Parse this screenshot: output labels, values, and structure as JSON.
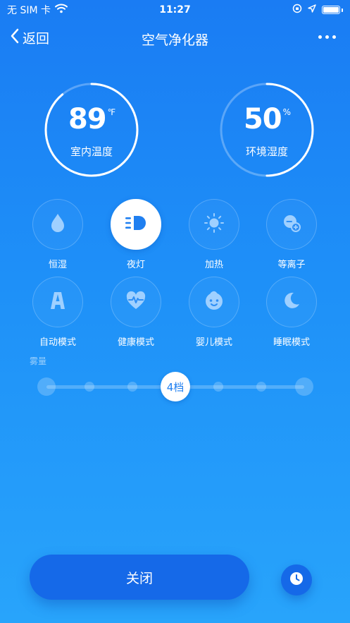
{
  "status_bar": {
    "carrier": "无 SIM 卡",
    "time": "11:27"
  },
  "nav": {
    "back_label": "返回",
    "title": "空气净化器"
  },
  "gauges": {
    "temperature": {
      "value": "89",
      "unit": "℉",
      "label": "室内温度",
      "progress_fraction": 0.89
    },
    "humidity": {
      "value": "50",
      "unit": "%",
      "label": "环境湿度",
      "progress_fraction": 0.5
    }
  },
  "modes": [
    {
      "label": "恒湿",
      "icon": "water-drop-icon",
      "active": false
    },
    {
      "label": "夜灯",
      "icon": "night-light-icon",
      "active": true
    },
    {
      "label": "加热",
      "icon": "sun-icon",
      "active": false
    },
    {
      "label": "等离子",
      "icon": "plasma-icon",
      "active": false
    },
    {
      "label": "自动模式",
      "icon": "auto-a-icon",
      "active": false
    },
    {
      "label": "健康模式",
      "icon": "heart-pulse-icon",
      "active": false
    },
    {
      "label": "婴儿模式",
      "icon": "baby-face-icon",
      "active": false
    },
    {
      "label": "睡眠模式",
      "icon": "moon-icon",
      "active": false
    }
  ],
  "mist": {
    "label": "雾量",
    "level_label": "4档",
    "level": 4,
    "levels": 7
  },
  "actions": {
    "off_label": "关闭",
    "timer_icon": "clock-icon"
  },
  "colors": {
    "accent": "#1f7ff0",
    "button": "#1569e8",
    "icon_light": "#9fd0ff"
  }
}
